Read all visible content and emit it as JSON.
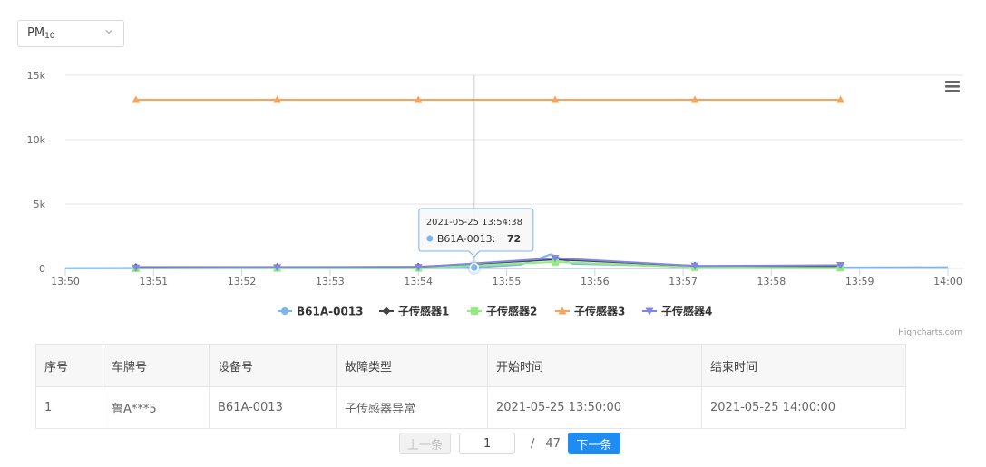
{
  "selector": {
    "value": "PM",
    "sub": "10"
  },
  "chart_data": {
    "type": "line",
    "x_range": [
      "13:50",
      "14:00"
    ],
    "x_ticks": [
      "13:50",
      "13:51",
      "13:52",
      "13:53",
      "13:54",
      "13:55",
      "13:56",
      "13:57",
      "13:58",
      "13:59",
      "14:00"
    ],
    "ylim": [
      0,
      15000
    ],
    "y_ticks": [
      0,
      5000,
      10000,
      15000
    ],
    "y_tick_labels": [
      "0",
      "5k",
      "10k",
      "15k"
    ],
    "grid": true,
    "legend_position": "bottom",
    "series": [
      {
        "name": "B61A-0013",
        "color": "#7cb5ec",
        "marker": "circle",
        "showMarkers": false,
        "x": [
          "13:50:00",
          "13:51:00",
          "13:52:00",
          "13:53:00",
          "13:54:00",
          "13:54:38",
          "13:55:10",
          "13:55:30",
          "13:55:45",
          "13:56:10",
          "13:57:00",
          "13:58:00",
          "13:59:00",
          "14:00:00"
        ],
        "y": [
          30,
          40,
          50,
          40,
          60,
          72,
          300,
          1100,
          350,
          300,
          150,
          100,
          80,
          100
        ]
      },
      {
        "name": "子传感器1",
        "color": "#434348",
        "marker": "diamond",
        "showMarkers": true,
        "x": [
          "13:50:48",
          "13:52:24",
          "13:54:00",
          "13:55:33",
          "13:57:08",
          "13:58:47"
        ],
        "y": [
          100,
          100,
          120,
          700,
          200,
          150
        ]
      },
      {
        "name": "子传感器2",
        "color": "#90ed7d",
        "marker": "square",
        "showMarkers": true,
        "x": [
          "13:50:48",
          "13:52:24",
          "13:54:00",
          "13:55:33",
          "13:57:08",
          "13:58:47"
        ],
        "y": [
          0,
          20,
          30,
          500,
          80,
          50
        ]
      },
      {
        "name": "子传感器3",
        "color": "#f7a35c",
        "marker": "triangle",
        "showMarkers": true,
        "x": [
          "13:50:48",
          "13:52:24",
          "13:54:00",
          "13:55:33",
          "13:57:08",
          "13:58:47"
        ],
        "y": [
          13100,
          13100,
          13100,
          13100,
          13100,
          13100
        ]
      },
      {
        "name": "子传感器4",
        "color": "#8085e9",
        "marker": "triangle-down",
        "showMarkers": true,
        "x": [
          "13:50:48",
          "13:52:24",
          "13:54:00",
          "13:55:33",
          "13:57:08",
          "13:58:47"
        ],
        "y": [
          50,
          80,
          100,
          800,
          200,
          250
        ]
      }
    ],
    "tooltip": {
      "time": "2021-05-25 13:54:38",
      "series": "B61A-0013",
      "value": "72",
      "x": "13:54:38",
      "y": 72
    },
    "credits": "Highcharts.com"
  },
  "table": {
    "headers": [
      "序号",
      "车牌号",
      "设备号",
      "故障类型",
      "开始时间",
      "结束时间"
    ],
    "rows": [
      [
        "1",
        "鲁A***5",
        "B61A-0013",
        "子传感器异常",
        "2021-05-25 13:50:00",
        "2021-05-25 14:00:00"
      ]
    ]
  },
  "pager": {
    "prev": "上一条",
    "current": "1",
    "slash": "/",
    "total": "47",
    "next": "下一条"
  }
}
